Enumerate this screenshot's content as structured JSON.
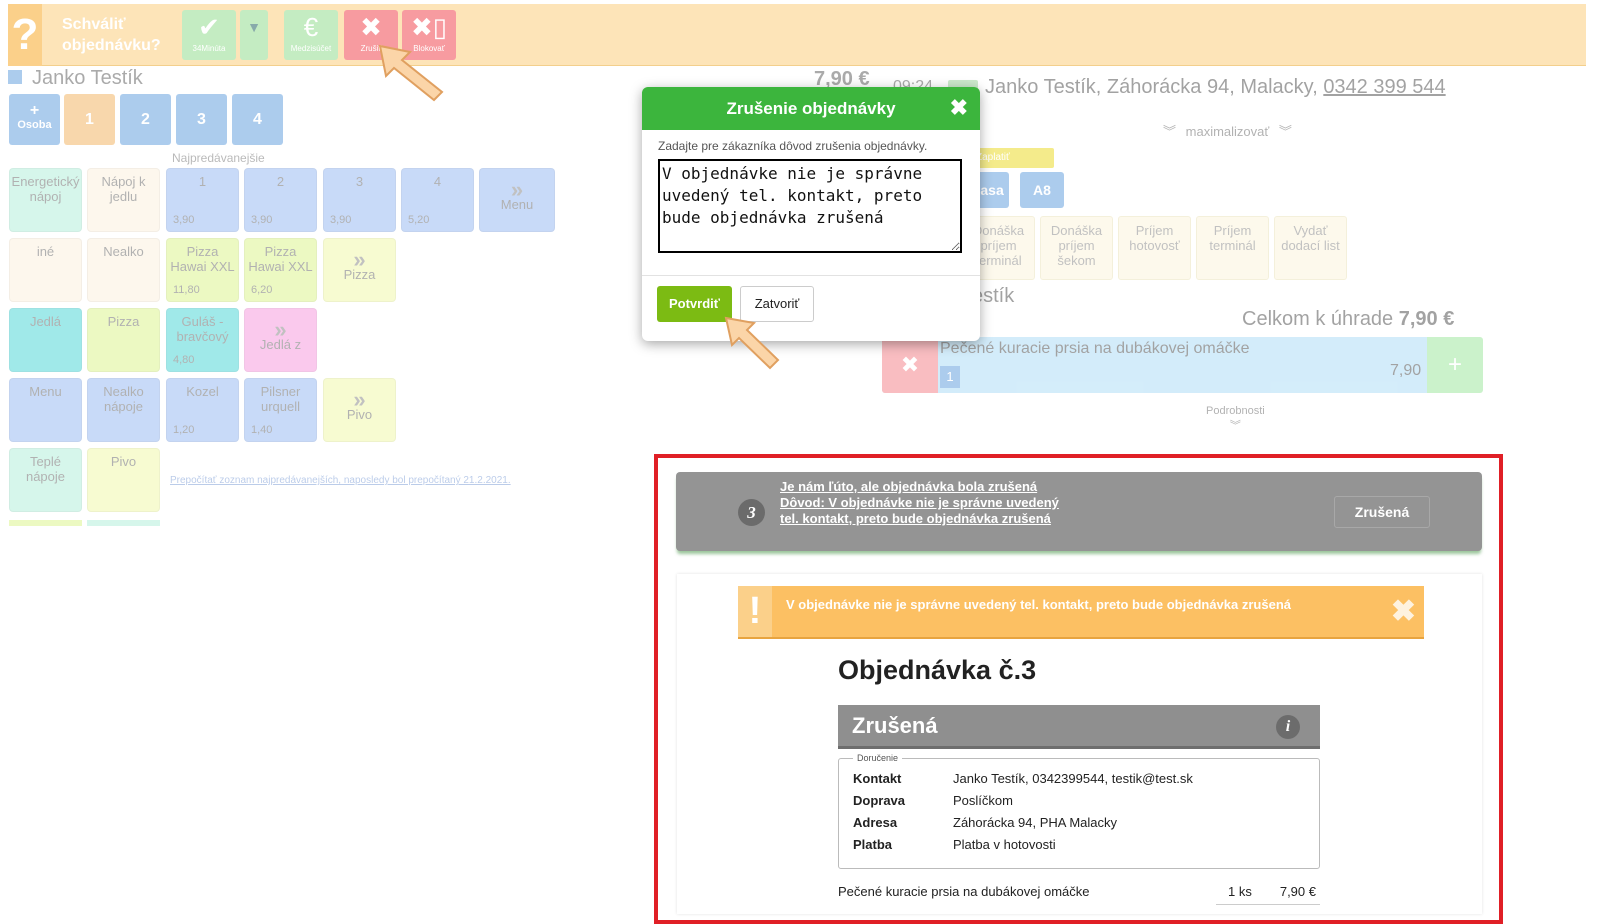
{
  "toolbar": {
    "question_icon": "?",
    "approve_label_line1": "Schváliť",
    "approve_label_line2": "objednávku?",
    "buttons": [
      {
        "icon": "check-icon",
        "label": "34Minúta"
      },
      {
        "icon": "chevron-down-icon",
        "label": ""
      },
      {
        "icon": "euro-icon",
        "label": "Medzisúčet"
      },
      {
        "icon": "close-icon",
        "label": "Zrušiť"
      },
      {
        "icon": "block-phone-icon",
        "label": "Blokovať"
      }
    ]
  },
  "customer": {
    "name": "Janko Testík"
  },
  "persons": {
    "add_label": "Osoba",
    "items": [
      "1",
      "2",
      "3",
      "4"
    ]
  },
  "bestsellers_label": "Najpredávanejšie",
  "tiles": [
    {
      "label": "Energetický nápoj",
      "price": ""
    },
    {
      "label": "Nápoj k jedlu",
      "price": ""
    },
    {
      "label": "1",
      "price": "3,90"
    },
    {
      "label": "2",
      "price": "3,90"
    },
    {
      "label": "3",
      "price": "3,90"
    },
    {
      "label": "4",
      "price": "5,20"
    },
    {
      "label": "Menu",
      "price": ""
    },
    {
      "label": "iné",
      "price": ""
    },
    {
      "label": "Nealko",
      "price": ""
    },
    {
      "label": "Pizza Hawai XXL",
      "price": "11,80"
    },
    {
      "label": "Pizza Hawai XXL",
      "price": "6,20"
    },
    {
      "label": "Pizza",
      "price": ""
    },
    {
      "label": "Jedlá",
      "price": ""
    },
    {
      "label": "Pizza",
      "price": ""
    },
    {
      "label": "Guláš - bravčový",
      "price": "4,80"
    },
    {
      "label": "Jedlá z",
      "price": ""
    },
    {
      "label": "Menu",
      "price": ""
    },
    {
      "label": "Nealko nápoje",
      "price": ""
    },
    {
      "label": "Kozel",
      "price": "1,20"
    },
    {
      "label": "Pilsner urquell",
      "price": "1,40"
    },
    {
      "label": "Pivo",
      "price": ""
    },
    {
      "label": "Teplé nápoje",
      "price": ""
    },
    {
      "label": "Pivo",
      "price": ""
    }
  ],
  "recalc_link": "Prepočítať zoznam najpredávanejších, naposledy bol prepočítaný 21.2.2021.",
  "order_header": {
    "price": "7,90 €",
    "time": "09:24",
    "customer_line": "Janko Testík, Záhorácka 94, Malacky,",
    "phone": "0342 399 544",
    "maximize": "maximalizovať",
    "pay_cash_tag": "Zaplatiť hotovosťou",
    "kasa": "Kasa",
    "a8": "A8",
    "options": [
      "Donáška príjem terminál",
      "Donáška príjem šekom",
      "Príjem hotovosť",
      "Príjem terminál",
      "Vydať dodací list"
    ],
    "customer_short": "Testík",
    "total_label": "Celkom k úhrade",
    "total_value": "7,90 €",
    "item_name": "Pečené kuracie prsia na dubákovej omáčke",
    "item_qty": "1",
    "item_price": "7,90",
    "details": "Podrobnosti"
  },
  "modal": {
    "title": "Zrušenie objednávky",
    "prompt": "Zadajte pre zákazníka dôvod zrušenia objednávky.",
    "reason": "V objednávke nie je správne uvedený tel. kontakt, preto bude objednávka zrušená",
    "confirm": "Potvrdiť",
    "close": "Zatvoriť"
  },
  "cancel_notice": {
    "number": "3",
    "line1": "Je nám ľúto, ale objednávka bola zrušená",
    "line2": "Dôvod: V objednávke nie je správne uvedený tel. kontakt, preto bude objednávka zrušená",
    "status": "Zrušená"
  },
  "document": {
    "warning_icon": "!",
    "warning": "V objednávke nie je správne uvedený tel. kontakt, preto bude objednávka zrušená",
    "title": "Objednávka č.3",
    "status": "Zrušená",
    "info_icon": "i",
    "delivery_legend": "Doručenie",
    "rows": [
      {
        "k": "Kontakt",
        "v": "Janko Testík, 0342399544, testik@test.sk"
      },
      {
        "k": "Doprava",
        "v": "Poslíčkom"
      },
      {
        "k": "Adresa",
        "v": "Záhorácka 94, PHA Malacky"
      },
      {
        "k": "Platba",
        "v": "Platba v hotovosti"
      }
    ],
    "item": {
      "name": "Pečené kuracie prsia na dubákovej omáčke",
      "qty": "1 ks",
      "price": "7,90 €"
    }
  },
  "colors": {
    "green": "#3cb53d",
    "red": "#e01f26",
    "orange": "#fcc063",
    "grey": "#949494"
  }
}
